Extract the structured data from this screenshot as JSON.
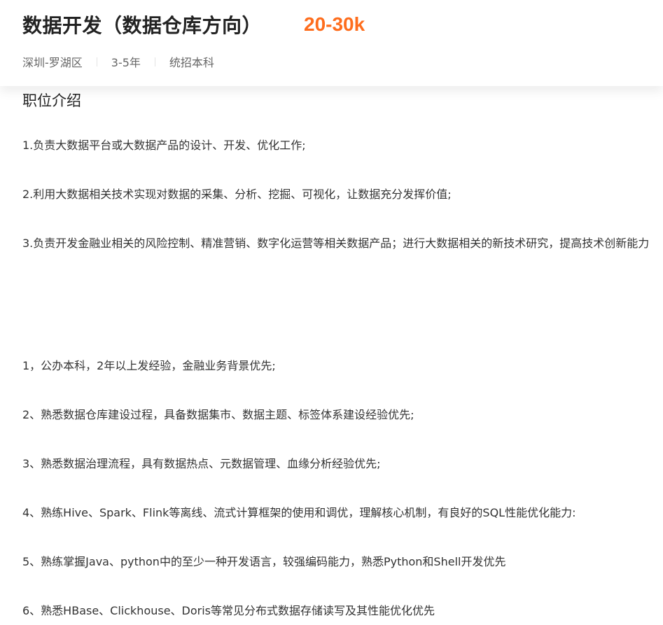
{
  "job": {
    "title": "数据开发（数据仓库方向）",
    "salary": "20-30k",
    "location": "深圳-罗湖区",
    "experience": "3-5年",
    "education": "统招本科"
  },
  "description": {
    "section_title": "职位介绍",
    "responsibilities": [
      "1.负责大数据平台或大数据产品的设计、开发、优化工作;",
      "2.利用大数据相关技术实现对数据的采集、分析、挖掘、可视化，让数据充分发挥价值;",
      "3.负责开发金融业相关的风险控制、精准营销、数字化运营等相关数据产品；进行大数据相关的新技术研究，提高技术创新能力"
    ],
    "requirements": [
      "1，公办本科，2年以上发经验，金融业务背景优先;",
      "2、熟悉数据仓库建设过程，具备数据集市、数据主题、标签体系建设经验优先;",
      "3、熟悉数据治理流程，具有数据热点、元数据管理、血缘分析经验优先;",
      "4、熟练Hive、Spark、Flink等离线、流式计算框架的使用和调优，理解核心机制，有良好的SQL性能优化能力:",
      "5、熟练掌握Java、python中的至少一种开发语言，较强编码能力，熟悉Python和Shell开发优先",
      "6、熟悉HBase、Clickhouse、Doris等常见分布式数据存储读写及其性能优化优先"
    ]
  }
}
